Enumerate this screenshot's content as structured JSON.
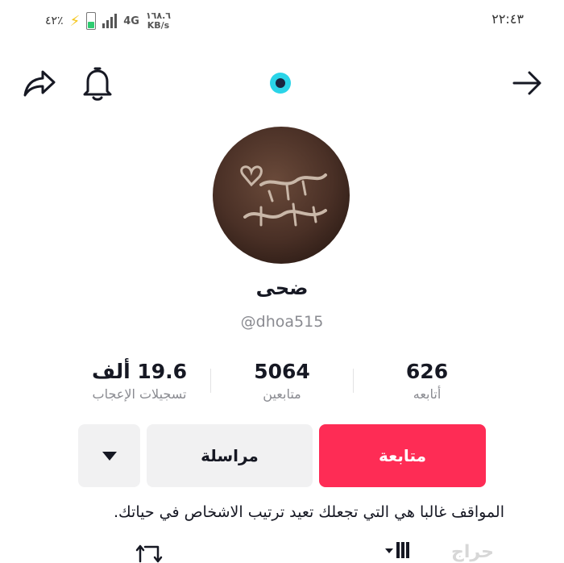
{
  "status_bar": {
    "battery_percent": "٤٢٪",
    "network_type": "4G",
    "net_speed_value": "١٦٨.٦",
    "net_speed_unit": "KB/s",
    "time": "٢٢:٤٣"
  },
  "profile": {
    "display_name": "ضحى",
    "username": "@dhoa515"
  },
  "stats": {
    "likes_value": "19.6 ألف",
    "likes_label": "تسجيلات الإعجاب",
    "followers_value": "5064",
    "followers_label": "متابعين",
    "following_value": "626",
    "following_label": "أتابعه"
  },
  "actions": {
    "follow_label": "متابعة",
    "message_label": "مراسلة"
  },
  "bio": "المواقف غالبا هي التي تجعلك تعيد ترتيب الاشخاص في حياتك.",
  "watermark": "حراج",
  "icons": {
    "share": "share-icon",
    "bell": "bell-icon",
    "back": "arrow-right-icon",
    "more": "triangle-down-icon",
    "repost": "repost-icon",
    "grid": "grid-tab-icon"
  },
  "colors": {
    "follow_button": "#fe2c55",
    "secondary_button": "#f1f1f2",
    "live_indicator": "#2ad4e8"
  }
}
